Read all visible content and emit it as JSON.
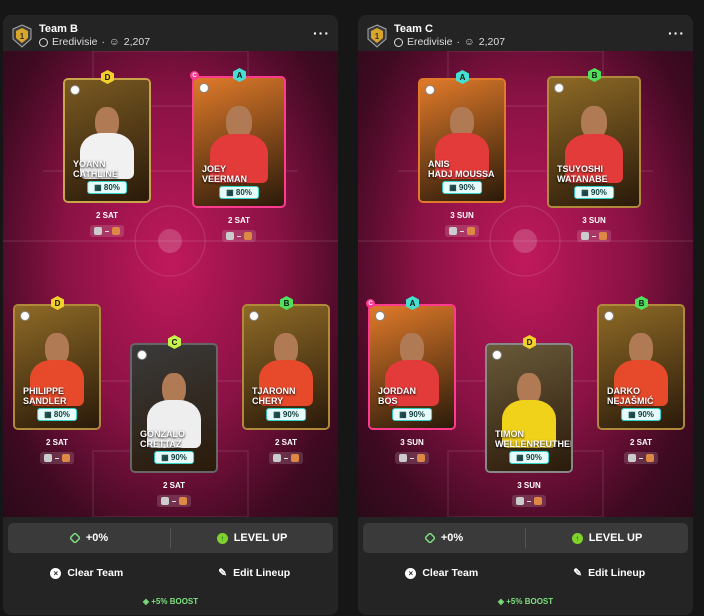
{
  "teams": [
    {
      "name": "Team B",
      "league": "Eredivisie",
      "count": "2,207",
      "more_icon": "more-dots-icon",
      "players": [
        {
          "first": "YOANN",
          "last": "CATHLINE",
          "pct": "80%",
          "when": "2 SAT",
          "badge": "D",
          "captain": false,
          "art": "#7a5a22",
          "shirt": "#f1f1f1",
          "border": "#c9a54a"
        },
        {
          "first": "JOEY",
          "last": "VEERMAN",
          "pct": "80%",
          "when": "2 SAT",
          "badge": "A",
          "captain": true,
          "art": "#e07a2a",
          "shirt": "#e33a3a",
          "border": "#ff3b8f"
        },
        {
          "first": "PHILIPPE",
          "last": "SANDLER",
          "pct": "80%",
          "when": "2 SAT",
          "badge": "D",
          "captain": false,
          "art": "#8e6a26",
          "shirt": "#e74a2a",
          "border": "#b08a3a"
        },
        {
          "first": "GONZALO",
          "last": "CRETTAZ",
          "pct": "90%",
          "when": "2 SAT",
          "badge": "C",
          "captain": false,
          "art": "#3a3a3a",
          "shirt": "#eeeeee",
          "border": "#666"
        },
        {
          "first": "TJARONN",
          "last": "CHERY",
          "pct": "90%",
          "when": "2 SAT",
          "badge": "B",
          "captain": false,
          "art": "#8e6a26",
          "shirt": "#e74a2a",
          "border": "#b08a3a"
        }
      ],
      "boost_delta": "+0%",
      "level_up": "LEVEL UP",
      "clear": "Clear Team",
      "edit": "Edit Lineup",
      "boost": "+5% BOOST"
    },
    {
      "name": "Team C",
      "league": "Eredivisie",
      "count": "2,207",
      "more_icon": "more-dots-icon",
      "players": [
        {
          "first": "ANIS",
          "last": "HADJ MOUSSA",
          "pct": "90%",
          "when": "3 SUN",
          "badge": "A",
          "captain": false,
          "art": "#e07a2a",
          "shirt": "#e33a3a",
          "border": "#e07a2a"
        },
        {
          "first": "TSUYOSHI",
          "last": "WATANABE",
          "pct": "90%",
          "when": "3 SUN",
          "badge": "B",
          "captain": false,
          "art": "#8e6a26",
          "shirt": "#e33a3a",
          "border": "#b08a3a"
        },
        {
          "first": "JORDAN",
          "last": "BOS",
          "pct": "90%",
          "when": "3 SUN",
          "badge": "A",
          "captain": true,
          "art": "#e07a2a",
          "shirt": "#e33a3a",
          "border": "#ff3b8f"
        },
        {
          "first": "TIMON",
          "last": "WELLENREUTHER",
          "pct": "90%",
          "when": "3 SUN",
          "badge": "D",
          "captain": false,
          "art": "#6a5a3a",
          "shirt": "#f1d21a",
          "border": "#888"
        },
        {
          "first": "DARKO",
          "last": "NEJAŠMIĆ",
          "pct": "90%",
          "when": "2 SAT",
          "badge": "B",
          "captain": false,
          "art": "#8e6a26",
          "shirt": "#e74a2a",
          "border": "#b08a3a"
        }
      ],
      "boost_delta": "+0%",
      "level_up": "LEVEL UP",
      "clear": "Clear Team",
      "edit": "Edit Lineup",
      "boost": "+5% BOOST"
    }
  ]
}
